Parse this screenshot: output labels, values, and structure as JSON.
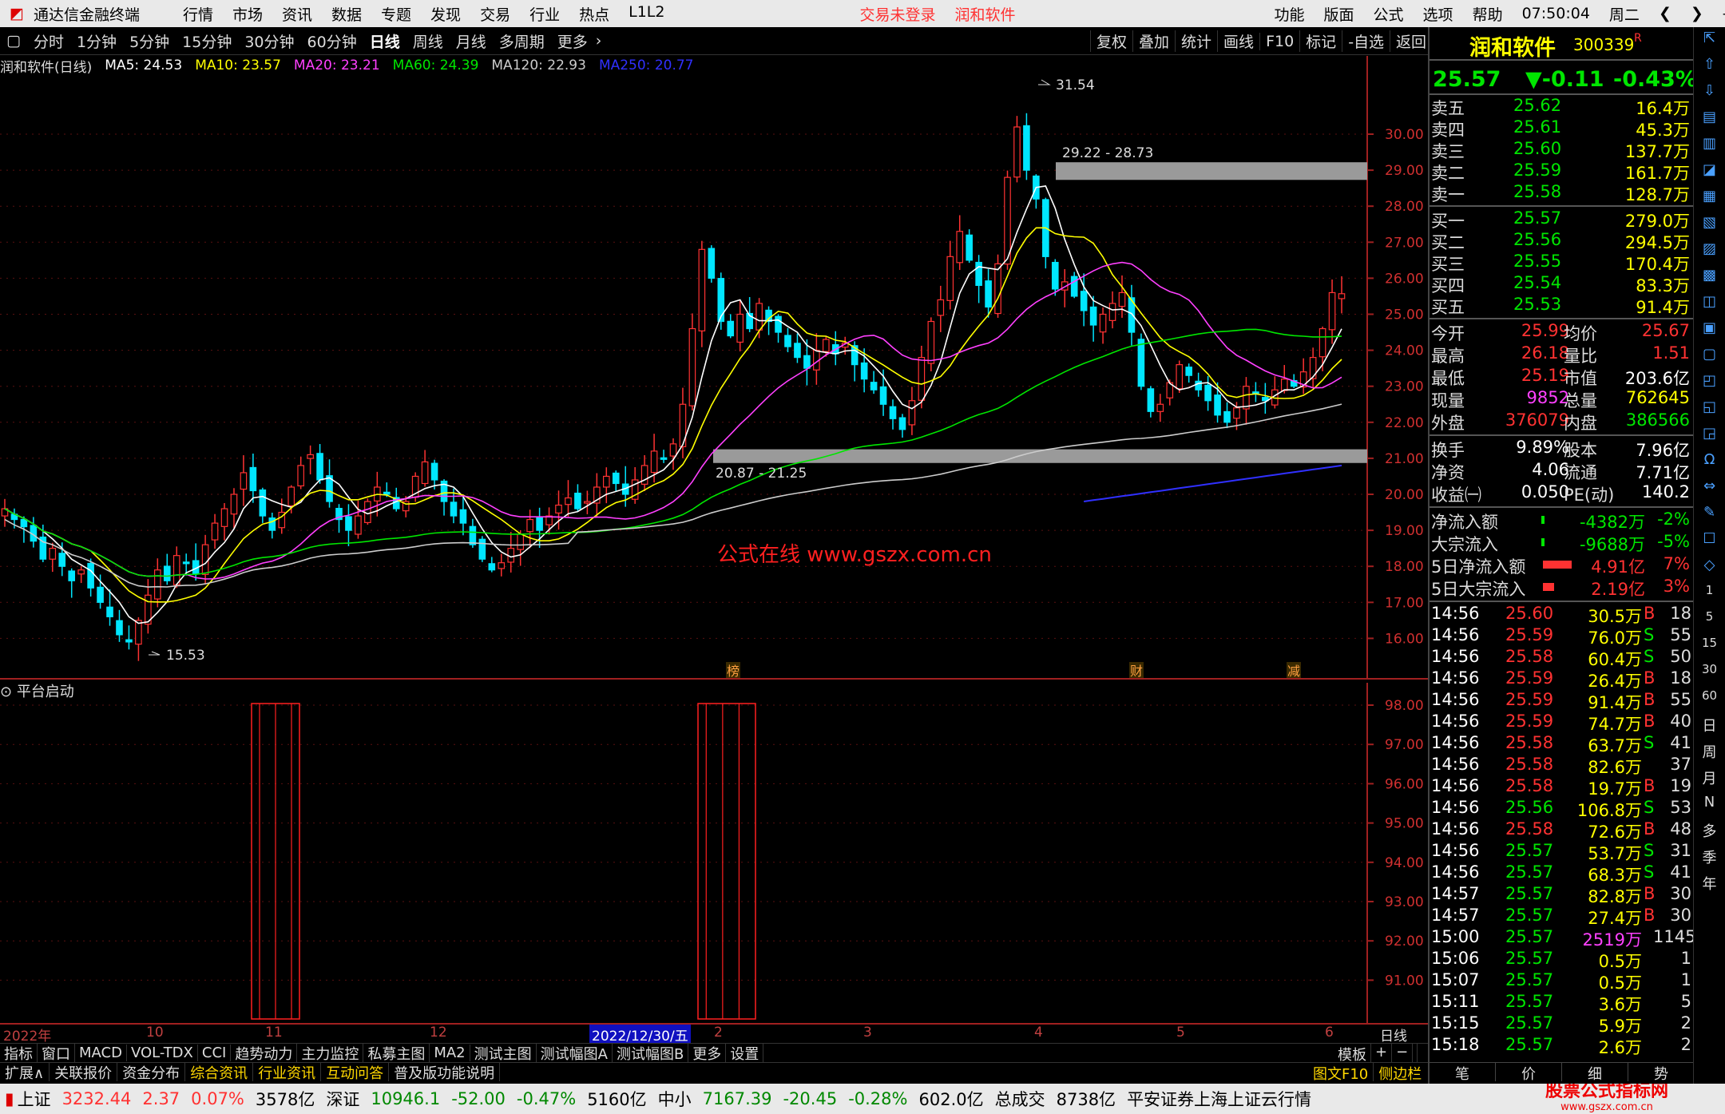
{
  "titlebar": {
    "app": "通达信金融终端",
    "menus": [
      "行情",
      "市场",
      "资讯",
      "数据",
      "专题",
      "发现",
      "交易",
      "行业",
      "热点",
      "L1L2"
    ],
    "notice": "交易未登录",
    "stock": "润和软件",
    "right": [
      "功能",
      "版面",
      "公式",
      "选项",
      "帮助"
    ],
    "time": "07:50:04",
    "weekday": "周二"
  },
  "periods": [
    "分时",
    "1分钟",
    "5分钟",
    "15分钟",
    "30分钟",
    "60分钟",
    "日线",
    "周线",
    "月线",
    "多周期",
    "更多"
  ],
  "active_period": "日线",
  "tools": [
    "复权",
    "叠加",
    "统计",
    "画线",
    "F10",
    "标记",
    "-自选",
    "返回"
  ],
  "legend": {
    "name": "润和软件(日线)",
    "ma5": "MA5: 24.53",
    "ma10": "MA10: 23.57",
    "ma20": "MA20: 23.21",
    "ma60": "MA60: 24.39",
    "ma120": "MA120: 22.93",
    "ma250": "MA250: 20.77"
  },
  "colors": {
    "up": "#ff3232",
    "down": "#00e6ff",
    "ma5": "#ffffff",
    "ma10": "#ffff00",
    "ma20": "#ff40ff",
    "ma60": "#00e600",
    "ma120": "#cccccc",
    "ma250": "#3030ff",
    "grid": "#5a1010"
  },
  "annotations": {
    "high": "31.54",
    "low": "15.53",
    "zone_top": "29.22 - 28.73",
    "zone_bottom": "20.87 - 21.25",
    "watermark": "公式在线 www.gszx.com.cn",
    "m1": "榜",
    "m2": "财",
    "m3": "减"
  },
  "sub": {
    "title": "平台启动"
  },
  "chart_data": {
    "type": "candlestick",
    "yaxis_main": [
      "30.00",
      "29.00",
      "28.00",
      "27.00",
      "26.00",
      "25.00",
      "24.00",
      "23.00",
      "22.00",
      "21.00",
      "20.00",
      "19.00",
      "18.00",
      "17.00",
      "16.00"
    ],
    "yaxis_sub": [
      "98.00",
      "97.00",
      "96.00",
      "95.00",
      "94.00",
      "93.00",
      "92.00",
      "91.00"
    ],
    "xaxis": [
      {
        "t": "2022年"
      },
      {
        "t": "10"
      },
      {
        "t": "11"
      },
      {
        "t": "12"
      },
      {
        "t": "2022/12/30/五"
      },
      {
        "t": "2"
      },
      {
        "t": "3"
      },
      {
        "t": "4"
      },
      {
        "t": "5"
      },
      {
        "t": "6"
      },
      {
        "t": "日线"
      }
    ],
    "closes": [
      19.6,
      19.3,
      19.1,
      18.7,
      18.2,
      18.5,
      18.0,
      17.6,
      17.9,
      17.4,
      17.0,
      16.6,
      16.1,
      15.9,
      16.5,
      17.2,
      17.9,
      17.6,
      18.3,
      18.1,
      17.8,
      18.6,
      19.2,
      19.6,
      20.0,
      20.6,
      20.1,
      19.4,
      19.0,
      19.5,
      20.2,
      20.8,
      21.1,
      20.4,
      19.8,
      19.3,
      19.0,
      19.4,
      19.8,
      20.2,
      20.0,
      19.6,
      19.8,
      20.5,
      20.9,
      20.4,
      19.8,
      19.4,
      19.2,
      18.6,
      18.2,
      17.9,
      18.1,
      18.5,
      18.9,
      19.3,
      19.0,
      19.4,
      19.7,
      19.9,
      19.6,
      19.8,
      20.2,
      20.5,
      20.3,
      20.0,
      20.4,
      20.8,
      21.2,
      21.0,
      21.4,
      22.5,
      24.6,
      26.8,
      26.0,
      24.8,
      24.4,
      25.0,
      24.6,
      25.3,
      24.8,
      24.5,
      24.1,
      23.8,
      23.5,
      24.0,
      24.3,
      23.9,
      24.2,
      23.6,
      23.2,
      22.9,
      22.5,
      22.1,
      21.8,
      22.6,
      23.8,
      24.8,
      25.4,
      26.6,
      27.3,
      26.5,
      25.8,
      25.2,
      26.4,
      28.8,
      30.2,
      29.0,
      28.2,
      26.6,
      25.7,
      25.9,
      25.5,
      25.1,
      24.7,
      25.0,
      25.3,
      25.6,
      24.5,
      23.0,
      22.3,
      22.5,
      23.1,
      23.6,
      23.3,
      22.9,
      22.6,
      22.2,
      22.0,
      22.4,
      23.0,
      22.8,
      22.6,
      22.9,
      23.2,
      23.0,
      23.4,
      23.8,
      24.6,
      25.6,
      25.57
    ]
  },
  "quote": {
    "name": "润和软件",
    "code": "300339",
    "flag": "R",
    "price": "25.57",
    "change": "▼-0.11",
    "pct": "-0.43%",
    "sells": [
      [
        "卖五",
        "25.62",
        "16.4万"
      ],
      [
        "卖四",
        "25.61",
        "45.3万"
      ],
      [
        "卖三",
        "25.60",
        "137.7万"
      ],
      [
        "卖二",
        "25.59",
        "161.7万"
      ],
      [
        "卖一",
        "25.58",
        "128.7万"
      ]
    ],
    "buys": [
      [
        "买一",
        "25.57",
        "279.0万"
      ],
      [
        "买二",
        "25.56",
        "294.5万"
      ],
      [
        "买三",
        "25.55",
        "170.4万"
      ],
      [
        "买四",
        "25.54",
        "83.3万"
      ],
      [
        "买五",
        "25.53",
        "91.4万"
      ]
    ],
    "stats": [
      [
        "今开",
        "25.99",
        "均价",
        "25.67"
      ],
      [
        "最高",
        "26.18",
        "量比",
        "1.51"
      ],
      [
        "最低",
        "25.19",
        "市值",
        "203.6亿"
      ],
      [
        "现量",
        "9852",
        "总量",
        "762645"
      ],
      [
        "外盘",
        "376079",
        "内盘",
        "386566"
      ],
      [
        "换手",
        "9.89%",
        "股本",
        "7.96亿"
      ],
      [
        "净资",
        "4.06",
        "流通",
        "7.71亿"
      ],
      [
        "收益㈠",
        "0.050",
        "PE(动)",
        "140.2"
      ]
    ],
    "flows": [
      [
        "净流入额",
        "-4382万",
        "-2%"
      ],
      [
        "大宗流入",
        "-9688万",
        "-5%"
      ],
      [
        "5日净流入额",
        "4.91亿",
        "7%"
      ],
      [
        "5日大宗流入",
        "2.19亿",
        "3%"
      ]
    ],
    "ticks": [
      [
        "14:56",
        "25.60",
        "30.5万",
        "B",
        "18"
      ],
      [
        "14:56",
        "25.59",
        "76.0万",
        "S",
        "55"
      ],
      [
        "14:56",
        "25.58",
        "60.4万",
        "S",
        "50"
      ],
      [
        "14:56",
        "25.59",
        "26.4万",
        "B",
        "18"
      ],
      [
        "14:56",
        "25.59",
        "91.4万",
        "B",
        "55"
      ],
      [
        "14:56",
        "25.59",
        "74.7万",
        "B",
        "40"
      ],
      [
        "14:56",
        "25.58",
        "63.7万",
        "S",
        "41"
      ],
      [
        "14:56",
        "25.58",
        "82.6万",
        "",
        "37"
      ],
      [
        "14:56",
        "25.58",
        "19.7万",
        "B",
        "19"
      ],
      [
        "14:56",
        "25.56",
        "106.8万",
        "S",
        "53"
      ],
      [
        "14:56",
        "25.58",
        "72.6万",
        "B",
        "48"
      ],
      [
        "14:56",
        "25.57",
        "53.7万",
        "S",
        "31"
      ],
      [
        "14:56",
        "25.57",
        "68.3万",
        "S",
        "41"
      ],
      [
        "14:57",
        "25.57",
        "82.8万",
        "B",
        "30"
      ],
      [
        "14:57",
        "25.57",
        "27.4万",
        "B",
        "30"
      ],
      [
        "15:00",
        "25.57",
        "2519万",
        "",
        "1145"
      ],
      [
        "15:06",
        "25.57",
        "0.5万",
        "",
        "1"
      ],
      [
        "15:07",
        "25.57",
        "0.5万",
        "",
        "1"
      ],
      [
        "15:11",
        "25.57",
        "3.6万",
        "",
        "5"
      ],
      [
        "15:15",
        "25.57",
        "5.9万",
        "",
        "2"
      ],
      [
        "15:18",
        "25.57",
        "2.6万",
        "",
        "2"
      ]
    ]
  },
  "tabs1": [
    "指标",
    "窗口",
    "MACD",
    "VOL-TDX",
    "CCI",
    "趋势动力",
    "主力监控",
    "私募主图",
    "MA2",
    "测试主图",
    "测试幅图A",
    "测试幅图B",
    "更多",
    "设置"
  ],
  "tabs1_right": [
    "模板",
    "+",
    "−"
  ],
  "tabs2": [
    "扩展∧",
    "关联报价",
    "资金分布",
    "综合资讯",
    "行业资讯",
    "互动问答",
    "普及版功能说明"
  ],
  "tabs2_right": [
    "图文F10",
    "侧边栏《"
  ],
  "rp_tabs": [
    "笔",
    "价",
    "细",
    "势"
  ],
  "status": {
    "sh_label": "上证",
    "sh": "3232.44",
    "sh_chg": "2.37",
    "sh_pct": "0.07%",
    "sh_amt": "3578亿",
    "sz_label": "深证",
    "sz": "10946.1",
    "sz_chg": "-52.00",
    "sz_pct": "-0.47%",
    "sz_amt": "5160亿",
    "zx_label": "中小",
    "zx": "7167.39",
    "zx_chg": "-20.45",
    "zx_pct": "-0.28%",
    "zx_amt": "602.0亿",
    "total_label": "总成交",
    "total": "8738亿",
    "broker": "平安证券上海上证云行情",
    "logo": "股票公式指标网",
    "logo_url": "www.gszx.com.cn"
  },
  "sidebar_letters": [
    "日",
    "周",
    "月",
    "N",
    "多",
    "季",
    "年"
  ]
}
